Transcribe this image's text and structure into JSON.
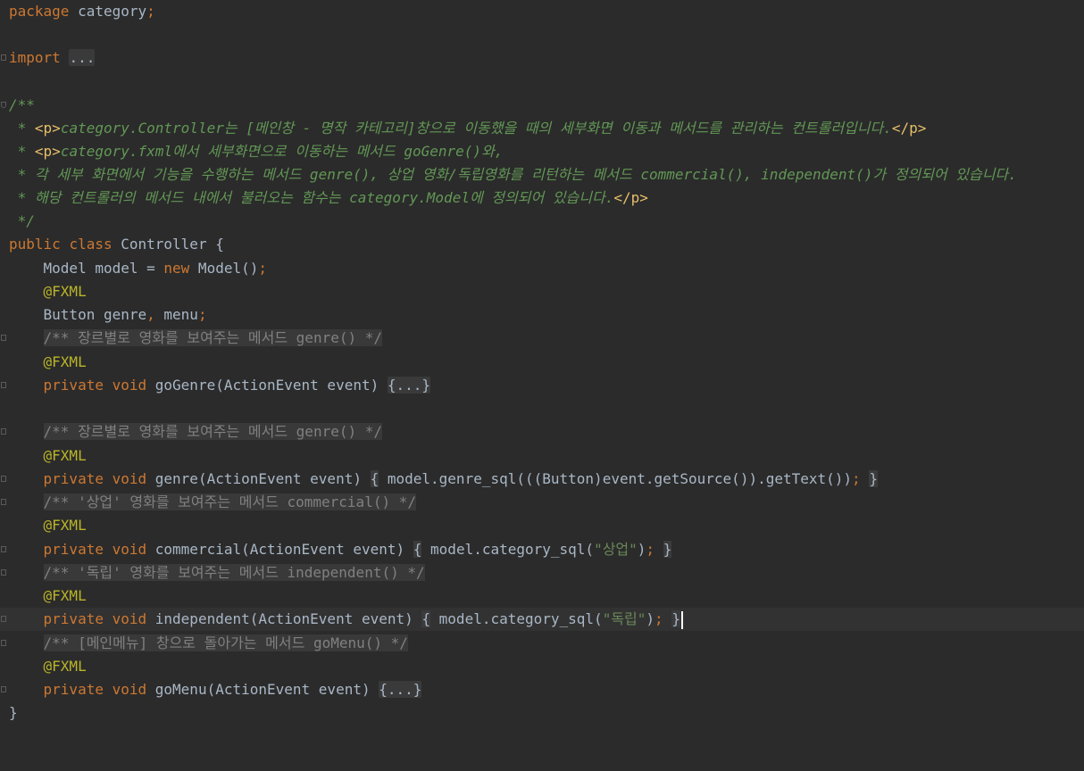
{
  "editor": {
    "package_kw": "package",
    "package_name": "category",
    "semicolon": ";",
    "import_kw": "import",
    "import_fold": "...",
    "doc": {
      "open": "/**",
      "line1_prefix": " * ",
      "line1_p_open": "<p>",
      "line1_text": "category.Controller는 [메인창 - 명작 카테고리]창으로 이동했을 때의 세부화면 이동과 메서드를 관리하는 컨트롤러입니다.",
      "line1_p_close": "</p>",
      "line2_prefix": " * ",
      "line2_p_open": "<p>",
      "line2_text": "category.fxml에서 세부화면으로 이동하는 메서드 goGenre()와,",
      "line3": " * 각 세부 화면에서 기능을 수행하는 메서드 genre(), 상업 영화/독립영화를 리턴하는 메서드 commercial(), independent()가 정의되어 있습니다.",
      "line4_text": " * 해당 컨트롤러의 메서드 내에서 불러오는 함수는 category.Model에 정의되어 있습니다.",
      "line4_p_close": "</p>",
      "close": " */"
    },
    "public_kw": "public",
    "class_kw": "class",
    "class_name": " Controller {",
    "model_decl": "    Model model = ",
    "new_kw": "new",
    "model_ctor": " Model()",
    "fxml_annotation": "@FXML",
    "button_decl": "    Button genre",
    "comma": ",",
    "button_menu": " menu",
    "private_kw": "private",
    "void_kw": "void",
    "comment_goGenre": "/** 장르별로 영화를 보여주는 메서드 genre() */",
    "sig_goGenre": " goGenre(ActionEvent event) ",
    "fold_body": "{...}",
    "comment_genre": "/** 장르별로 영화를 보여주는 메서드 genre() */",
    "sig_genre": " genre(ActionEvent event) ",
    "body_genre": " model.genre_sql(((Button)event.getSource()).getText())",
    "comment_commercial": "/** '상업' 영화를 보여주는 메서드 commercial() */",
    "sig_commercial": " commercial(ActionEvent event) ",
    "body_commercial_pre": " model.category_sql(",
    "str_commercial": "\"상업\"",
    "comment_independent": "/** '독립' 영화를 보여주는 메서드 independent() */",
    "sig_independent": " independent(ActionEvent event) ",
    "body_independent_pre": " model.category_sql(",
    "str_independent": "\"독립\"",
    "comment_goMenu": "/** [메인메뉴] 창으로 돌아가는 메서드 goMenu() */",
    "sig_goMenu": " goMenu(ActionEvent event) ",
    "open_brace": "{",
    "close_paren": ")",
    "close_brace": "}",
    "class_close": "}"
  }
}
